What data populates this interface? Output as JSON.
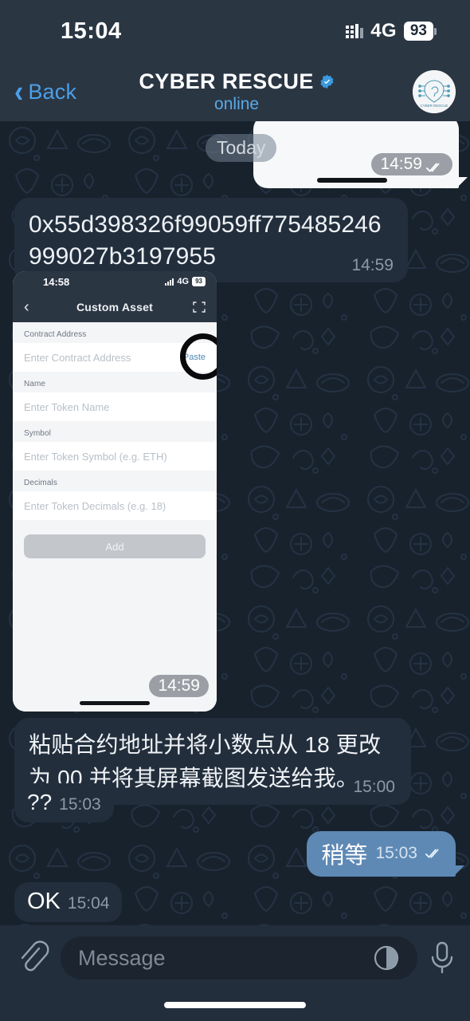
{
  "status_bar": {
    "time": "15:04",
    "network": "4G",
    "battery": "93",
    "signal_icon": "signal-bars-icon"
  },
  "header": {
    "back_label": "Back",
    "back_icon": "chevron-left-icon",
    "title": "CYBER RESCUE",
    "verified_icon": "verified-badge-icon",
    "status": "online",
    "avatar_icon": "cyber-rescue-avatar"
  },
  "chat": {
    "date_chip": "Today",
    "messages": [
      {
        "id": "outgoing-image",
        "type": "image",
        "direction": "out",
        "time": "14:59",
        "read_icon": "double-check-icon"
      },
      {
        "id": "contract-address",
        "type": "text",
        "direction": "in",
        "text": "0x55d398326f99059ff775485246999027b3197955",
        "time": "14:59"
      },
      {
        "id": "wallet-screenshot",
        "type": "image",
        "direction": "in",
        "time": "14:59"
      },
      {
        "id": "instruction-cn",
        "type": "text",
        "direction": "in",
        "text": "粘贴合约地址并将小数点从 18 更改为 00 并将其屏幕截图发送给我。",
        "time": "15:00"
      },
      {
        "id": "question-marks",
        "type": "text",
        "direction": "in",
        "text": "??",
        "time": "15:03"
      },
      {
        "id": "wait-reply",
        "type": "text",
        "direction": "out",
        "text": "稍等",
        "time": "15:03",
        "read_icon": "double-check-icon"
      },
      {
        "id": "ok-message",
        "type": "text",
        "direction": "in",
        "text": "OK",
        "time": "15:04"
      }
    ]
  },
  "embedded_screenshot": {
    "status_bar": {
      "time": "14:58",
      "network": "4G",
      "battery": "93"
    },
    "nav": {
      "back_icon": "chevron-left-icon",
      "title": "Custom Asset",
      "scan_icon": "qr-scan-icon"
    },
    "form": {
      "fields": [
        {
          "label": "Contract Address",
          "placeholder": "Enter Contract Address",
          "action": "Paste"
        },
        {
          "label": "Name",
          "placeholder": "Enter Token Name",
          "action": ""
        },
        {
          "label": "Symbol",
          "placeholder": "Enter Token Symbol (e.g. ETH)",
          "action": ""
        },
        {
          "label": "Decimals",
          "placeholder": "Enter Token Decimals (e.g. 18)",
          "action": ""
        }
      ],
      "submit_label": "Add"
    },
    "annotation": "black-circle-highlight"
  },
  "composer": {
    "attach_icon": "paperclip-icon",
    "placeholder": "Message",
    "sticker_icon": "sticker-icon",
    "mic_icon": "microphone-icon"
  },
  "colors": {
    "background": "#18222d",
    "header": "#2b3643",
    "incoming_bubble": "#222e3c",
    "outgoing_bubble": "#5e89b5",
    "accent": "#4a9fe8"
  }
}
